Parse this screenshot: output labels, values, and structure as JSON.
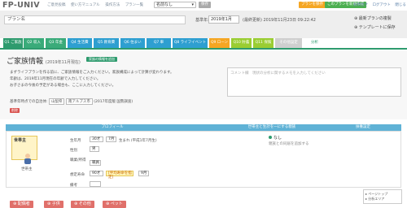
{
  "app": {
    "title": "FP-UNIV"
  },
  "topnav": {
    "items": [
      "ご意見投稿",
      "使い方マニュアル",
      "操作方法",
      "プラン一覧"
    ]
  },
  "plan_select": {
    "value": "名前なし"
  },
  "top_small_button": "保存",
  "top_orange_button": "プランを保存",
  "top_green_button": "このプランを新規作成",
  "toplinks": [
    "お問合せ",
    "ログアウト",
    "閉じる"
  ],
  "header": {
    "plan_name_placeholder": "プラン名",
    "base_date_label": "基準年:",
    "base_date_value": "2019年1月",
    "update_date": "(最終更新) 2019年11月23日 09:22:42",
    "side_links": [
      "最新プランの複製",
      "テンプレートに保存"
    ]
  },
  "tabs": [
    {
      "label": "Q1 ご家族",
      "color": "#2e9b6e"
    },
    {
      "label": "Q2 収入",
      "color": "#3aab7a"
    },
    {
      "label": "Q3 年金",
      "color": "#3aab7a"
    },
    {
      "label": "Q4 生活費",
      "color": "#2e9fd1"
    },
    {
      "label": "Q5 教育費",
      "color": "#2e9fd1"
    },
    {
      "label": "Q6 住まい",
      "color": "#2e9fd1"
    },
    {
      "label": "Q7 車",
      "color": "#2e9fd1"
    },
    {
      "label": "Q8 ライフイベント",
      "color": "#2e9fd1"
    },
    {
      "label": "Q9 ローン",
      "color": "#f5a623"
    },
    {
      "label": "Q10 貯蓄",
      "color": "#9acd32"
    },
    {
      "label": "Q11 保険",
      "color": "#9acd32"
    },
    {
      "label": "その他設定",
      "color": "#cfcfcf"
    },
    {
      "label": "分析",
      "color": "#ffffff"
    }
  ],
  "section": {
    "title": "ご家族情報",
    "subtitle": "(2019年11月現在)",
    "action_button": "家族の情報を追加",
    "description": [
      "まずライフプランを作る前に、ご家族情報をご入力ください。家族構成によって計算が変わります。",
      "年齢は、2019年11月現在の年齢で入力してください。",
      "お子さまの今後の予定がある場合も、ここに入力してください。"
    ],
    "memo_placeholder": "コメント欄　現状の分析に関するメモを入力してください",
    "base_age_text": "基準年時点での自治体:",
    "base_age_pills": [
      "山梨県",
      "南アルプス市"
    ],
    "base_age_note": "(2017年度版 国勢調査)",
    "red_button": "削除"
  },
  "table": {
    "headers": [
      "プロフィール",
      "世帯主と生計を一にする親族",
      "扶養設定"
    ],
    "person": {
      "name": "世帯主",
      "role": "世帯主"
    },
    "fields": {
      "birthday_label": "生年月",
      "birthday_year": "30才",
      "birthday_month": "7月",
      "birthday_suffix": "生まれ (平成1年7月生)",
      "gender_label": "性別",
      "gender_value": "男",
      "job_label": "職業/所得",
      "job_value": "職員",
      "retire_label": "想定寿命",
      "retire_age": "90才",
      "retire_mark": "[平均寿命を指定]",
      "retire_month": "9月",
      "note_label": "備考"
    },
    "relative": {
      "option": "なし",
      "note": "親族との同居を追加する"
    }
  },
  "add_buttons": [
    "配偶者",
    "子供",
    "その他",
    "ペット"
  ],
  "floating": {
    "items": [
      "ページトップ",
      "分析エリア"
    ]
  }
}
